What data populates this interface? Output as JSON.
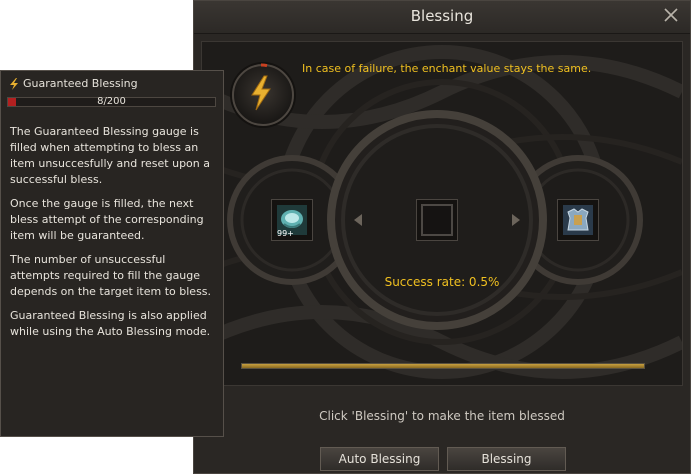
{
  "window": {
    "title": "Blessing",
    "notice": "In case of failure, the enchant value stays the same.",
    "success_rate": "Success rate: 0.5%",
    "instruction": "Click 'Blessing' to make the item blessed",
    "progress": 1.0,
    "buttons": {
      "auto_blessing": "Auto Blessing",
      "blessing": "Blessing"
    },
    "slots": {
      "material_stack": "99+",
      "material_icon": "blessing-scroll-icon",
      "target_icon": "armor-icon"
    }
  },
  "tooltip": {
    "title": "Guaranteed Blessing",
    "gauge_text": "8/200",
    "gauge_current": 8,
    "gauge_max": 200,
    "paragraphs": [
      "The Guaranteed Blessing gauge is filled when attempting to bless an item unsuccesfully and reset upon a successful bless.",
      "Once the gauge is filled, the next bless attempt of the corresponding item will be guaranteed.",
      "The number of unsuccessful attempts required to fill the gauge depends on the target item to bless.",
      "Guaranteed Blessing is also applied while using the Auto Blessing mode."
    ]
  },
  "colors": {
    "accent_text": "#f0c020",
    "gauge_fill": "#b22020",
    "progress_fill": "#c8a040"
  }
}
